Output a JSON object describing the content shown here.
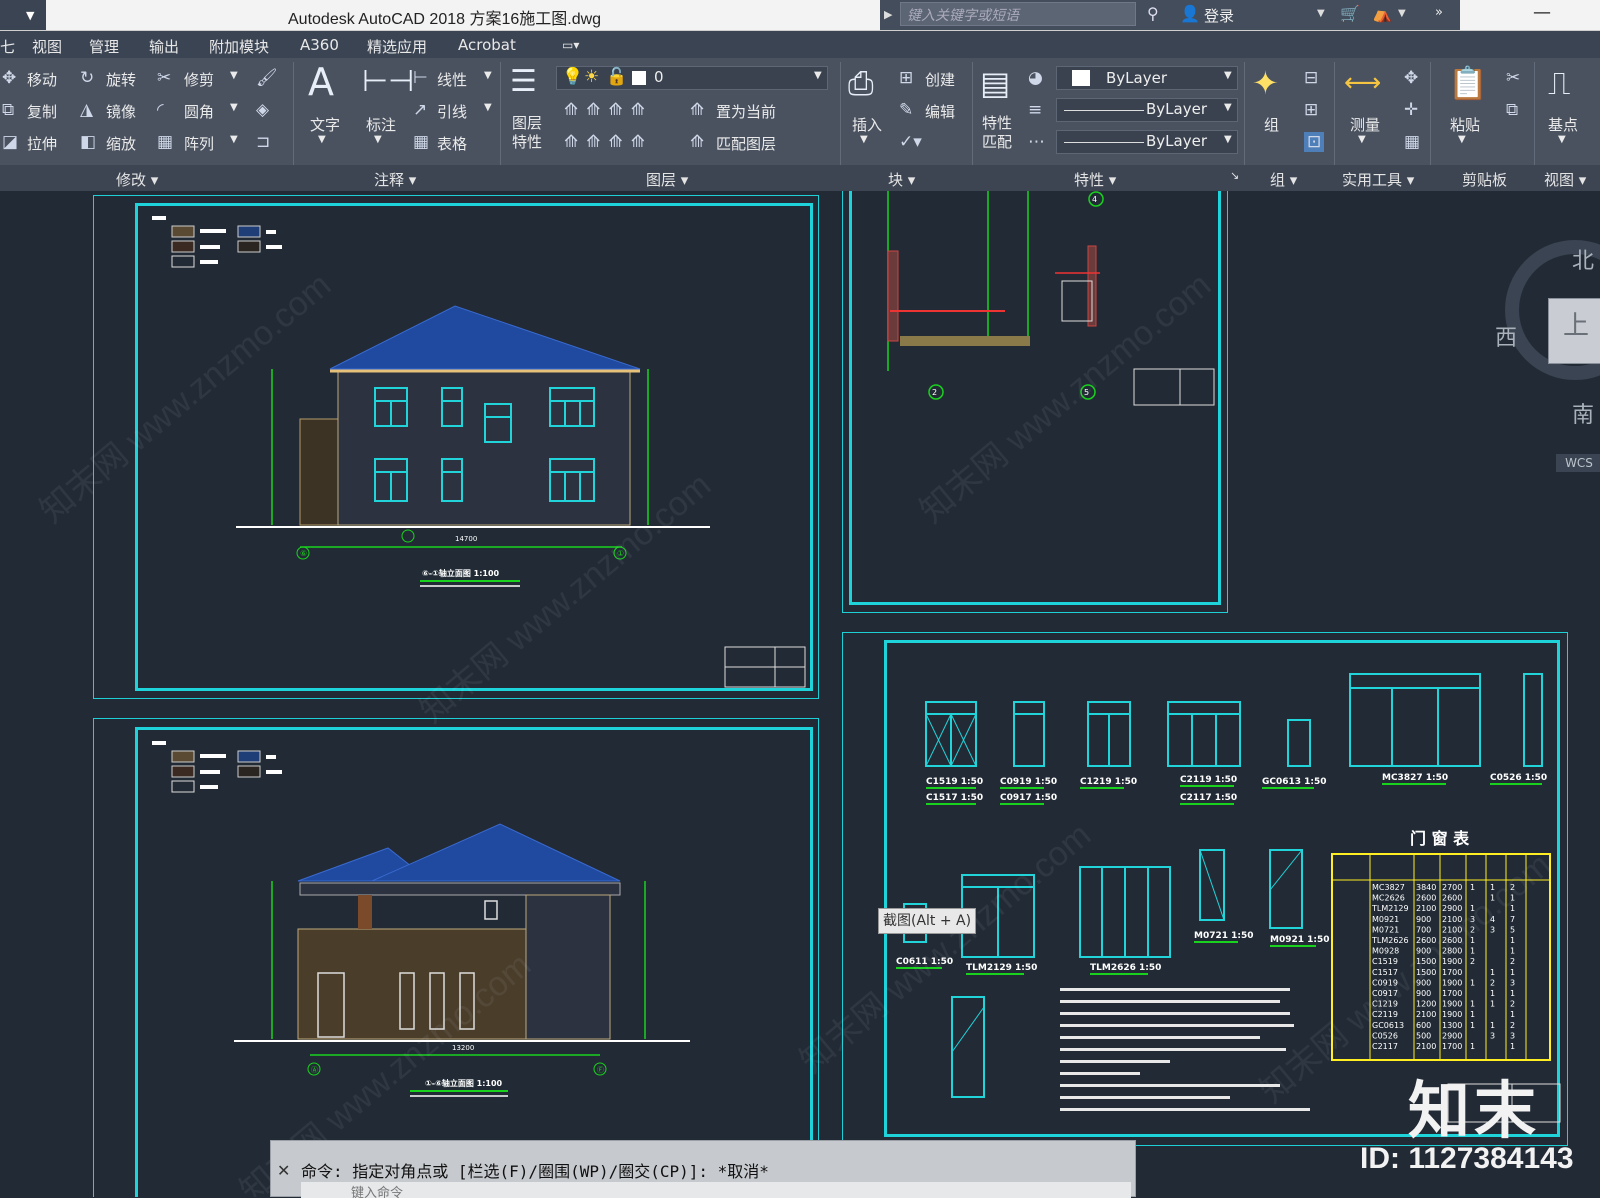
{
  "window": {
    "title": "Autodesk AutoCAD 2018    方案16施工图.dwg",
    "search_placeholder": "键入关键字或短语",
    "login": "登录"
  },
  "ribbon_tabs": [
    "视图",
    "管理",
    "输出",
    "附加模块",
    "A360",
    "精选应用",
    "Acrobat"
  ],
  "modify": {
    "move": "移动",
    "rotate": "旋转",
    "trim": "修剪",
    "copy": "复制",
    "mirror": "镜像",
    "fillet": "圆角",
    "stretch": "拉伸",
    "scale": "缩放",
    "array": "阵列",
    "panel": "修改"
  },
  "annotation": {
    "text": "文字",
    "dimension": "标注",
    "linear": "线性",
    "leader": "引线",
    "table": "表格",
    "panel": "注释"
  },
  "layers": {
    "properties": "图层\n特性",
    "current_layer": "0",
    "set_current": "置为当前",
    "match_layer": "匹配图层",
    "panel": "图层"
  },
  "block": {
    "insert": "插入",
    "create": "创建",
    "edit": "编辑",
    "panel": "块"
  },
  "properties": {
    "match": "特性\n匹配",
    "color": "ByLayer",
    "linetype": "ByLayer",
    "lineweight": "ByLayer",
    "panel": "特性"
  },
  "groups": {
    "group": "组",
    "panel": "组"
  },
  "utilities": {
    "measure": "测量",
    "panel": "实用工具"
  },
  "clipboard": {
    "paste": "粘贴",
    "panel": "剪贴板"
  },
  "view": {
    "base": "基点",
    "panel": "视图"
  },
  "viewcube": {
    "north": "北",
    "west": "西",
    "south": "南",
    "top": "上",
    "wcs": "WCS"
  },
  "drawings": {
    "elev1_title": "⑥-①轴立面图 1:100",
    "elev2_title": "①-⑥轴立面图 1:100",
    "elev1_width": "14700",
    "elev2_width": "13200",
    "elev1_axes": [
      "⑥",
      "①"
    ],
    "elev2_axes": [
      "Ⓐ",
      "Ⓕ"
    ],
    "door_table_title": "门    窗    表",
    "window_labels": [
      "C1519 1:50",
      "C0919 1:50",
      "C1219 1:50",
      "C2119 1:50",
      "GC0613 1:50",
      "MC3827 1:50",
      "C0526 1:50",
      "C1517 1:50",
      "C0917 1:50",
      "C2117 1:50",
      "C0611 1:50",
      "TLM2129 1:50",
      "TLM2626 1:50",
      "M0721 1:50",
      "M0921 1:50"
    ],
    "door_table": [
      [
        "MC3827",
        "3840",
        "2700",
        "1",
        "1",
        "2"
      ],
      [
        "MC2626",
        "2600",
        "2600",
        "",
        "1",
        "1"
      ],
      [
        "TLM2129",
        "2100",
        "2900",
        "1",
        "",
        "1"
      ],
      [
        "M0921",
        "900",
        "2100",
        "3",
        "4",
        "7"
      ],
      [
        "M0721",
        "700",
        "2100",
        "2",
        "3",
        "5"
      ],
      [
        "TLM2626",
        "2600",
        "2600",
        "1",
        "",
        "1"
      ],
      [
        "M0928",
        "900",
        "2800",
        "1",
        "",
        "1"
      ],
      [
        "C1519",
        "1500",
        "1900",
        "2",
        "",
        "2"
      ],
      [
        "C1517",
        "1500",
        "1700",
        "",
        "1",
        "1"
      ],
      [
        "C0919",
        "900",
        "1900",
        "1",
        "2",
        "3"
      ],
      [
        "C0917",
        "900",
        "1700",
        "",
        "1",
        "1"
      ],
      [
        "C1219",
        "1200",
        "1900",
        "1",
        "1",
        "2"
      ],
      [
        "C2119",
        "2100",
        "1900",
        "1",
        "",
        "1"
      ],
      [
        "GC0613",
        "600",
        "1300",
        "1",
        "1",
        "2"
      ],
      [
        "C0526",
        "500",
        "2900",
        "",
        "3",
        "3"
      ],
      [
        "C2117",
        "2100",
        "1700",
        "1",
        "",
        "1"
      ]
    ]
  },
  "command": {
    "prompt": "命令: 指定对角点或 [栏选(F)/圈围(WP)/圈交(CP)]: *取消*",
    "input_placeholder": "键入命令"
  },
  "screenshot_tip": "截图(Alt + A)",
  "watermark": {
    "logo": "知末",
    "id": "ID: 1127384143"
  }
}
